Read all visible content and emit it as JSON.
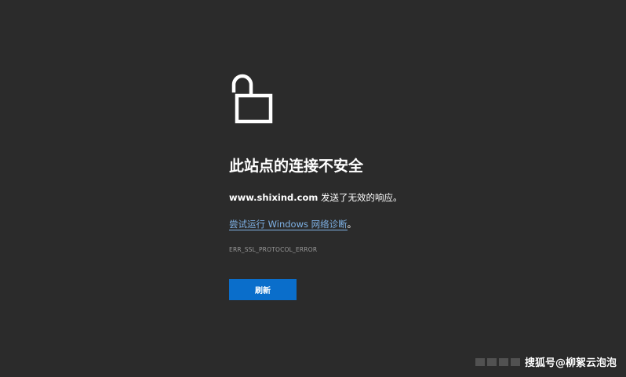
{
  "colors": {
    "background": "#2b2b2b",
    "title": "#ffffff",
    "link": "#7fb2e6",
    "error_code": "#9a9a9a",
    "button": "#0a6ecb"
  },
  "icon": {
    "name": "unlocked-padlock-icon"
  },
  "error_page": {
    "title": "此站点的连接不安全",
    "message_domain": "www.shixind.com",
    "message_text": " 发送了无效的响应。",
    "diagnose_link": "尝试运行 Windows 网络诊断",
    "diagnose_suffix": "。",
    "error_code": "ERR_SSL_PROTOCOL_ERROR",
    "refresh_label": "刷新"
  },
  "watermark": {
    "text": "搜狐号@柳絮云泡泡"
  }
}
